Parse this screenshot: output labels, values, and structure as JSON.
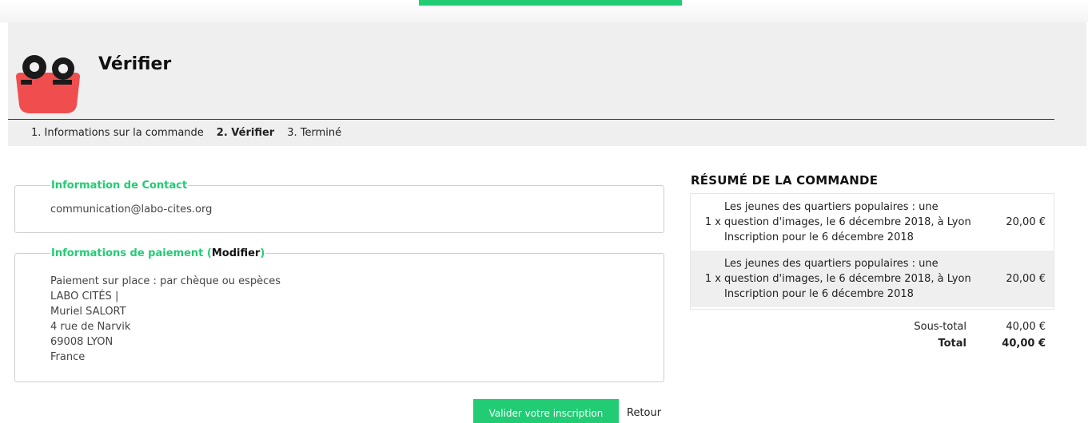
{
  "header": {
    "title": "Vérifier",
    "steps": [
      "1. Informations sur la commande",
      "2. Vérifier",
      "3. Terminé"
    ],
    "current_step_index": 1
  },
  "contact": {
    "legend": "Information de Contact",
    "email": "communication@labo-cites.org"
  },
  "payment": {
    "legend_prefix": "Informations de paiement (",
    "modify_label": "Modifier",
    "legend_suffix": ")",
    "lines": [
      "Paiement sur place : par chèque ou espèces",
      "LABO CITÉS |",
      "Muriel SALORT",
      "4 rue de Narvik",
      "69008 LYON",
      "France"
    ]
  },
  "actions": {
    "validate_label": "Valider votre inscription",
    "back_label": "Retour"
  },
  "summary": {
    "title": "RÉSUMÉ DE LA COMMANDE",
    "items": [
      {
        "qty": "1 x",
        "desc_lines": [
          "Les jeunes des quartiers populaires : une",
          "question d'images, le 6 décembre 2018, à Lyon",
          "Inscription pour le 6 décembre 2018"
        ],
        "price": "20,00 €"
      },
      {
        "qty": "1 x",
        "desc_lines": [
          "Les jeunes des quartiers populaires : une",
          "question d'images, le 6 décembre 2018, à Lyon",
          "Inscription pour le 6 décembre 2018"
        ],
        "price": "20,00 €"
      }
    ],
    "subtotal_label": "Sous-total",
    "subtotal_value": "40,00 €",
    "total_label": "Total",
    "total_value": "40,00 €"
  },
  "colors": {
    "accent": "#22cc74",
    "logo_red": "#f04e4e",
    "logo_dark": "#1a1a1a",
    "header_bg": "#efefef"
  },
  "icons": {
    "logo": "bag-logo-icon"
  }
}
